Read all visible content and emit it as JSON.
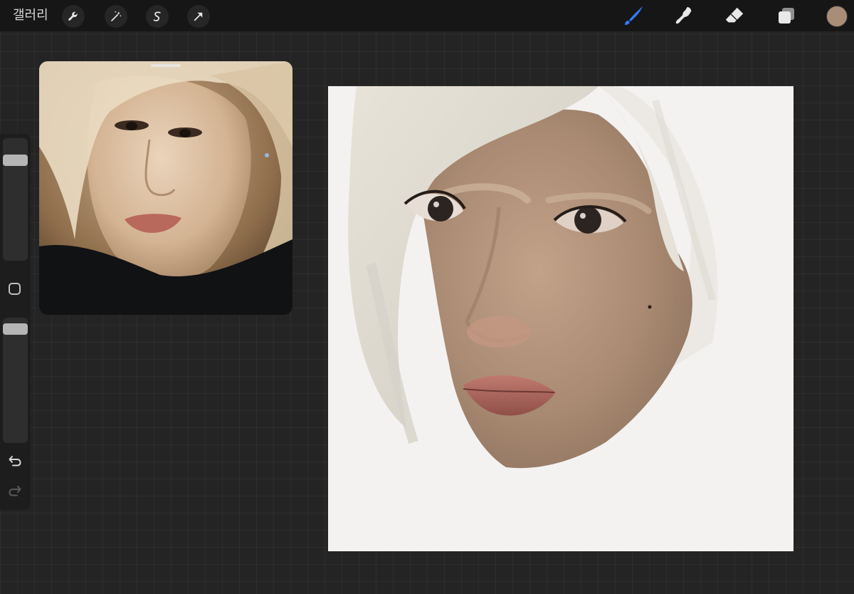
{
  "topbar": {
    "gallery_label": "갤러리",
    "left_tools": [
      {
        "name": "actions-wrench-icon"
      },
      {
        "name": "adjustments-magic-wand-icon"
      },
      {
        "name": "selection-s-icon"
      },
      {
        "name": "transform-arrow-icon"
      }
    ],
    "right_tools": [
      {
        "name": "brush-icon",
        "active": true,
        "color": "#2f7cf6"
      },
      {
        "name": "smudge-icon"
      },
      {
        "name": "eraser-icon"
      },
      {
        "name": "layers-icon"
      }
    ],
    "current_color": "#a98d76"
  },
  "sidebar": {
    "brush_size_level": 0.15,
    "opacity_level": 0.05,
    "buttons": [
      "modify-square",
      "undo",
      "redo"
    ]
  },
  "reference_panel": {
    "content": "reference-photo",
    "dominant_colors": [
      "#d9c3a6",
      "#e8d2b4",
      "#0f1114"
    ]
  },
  "canvas": {
    "background": "#f4f2f1",
    "content": "digital-painting-portrait",
    "skin_color": "#b29078",
    "hair_color": "#e6e3dd"
  }
}
